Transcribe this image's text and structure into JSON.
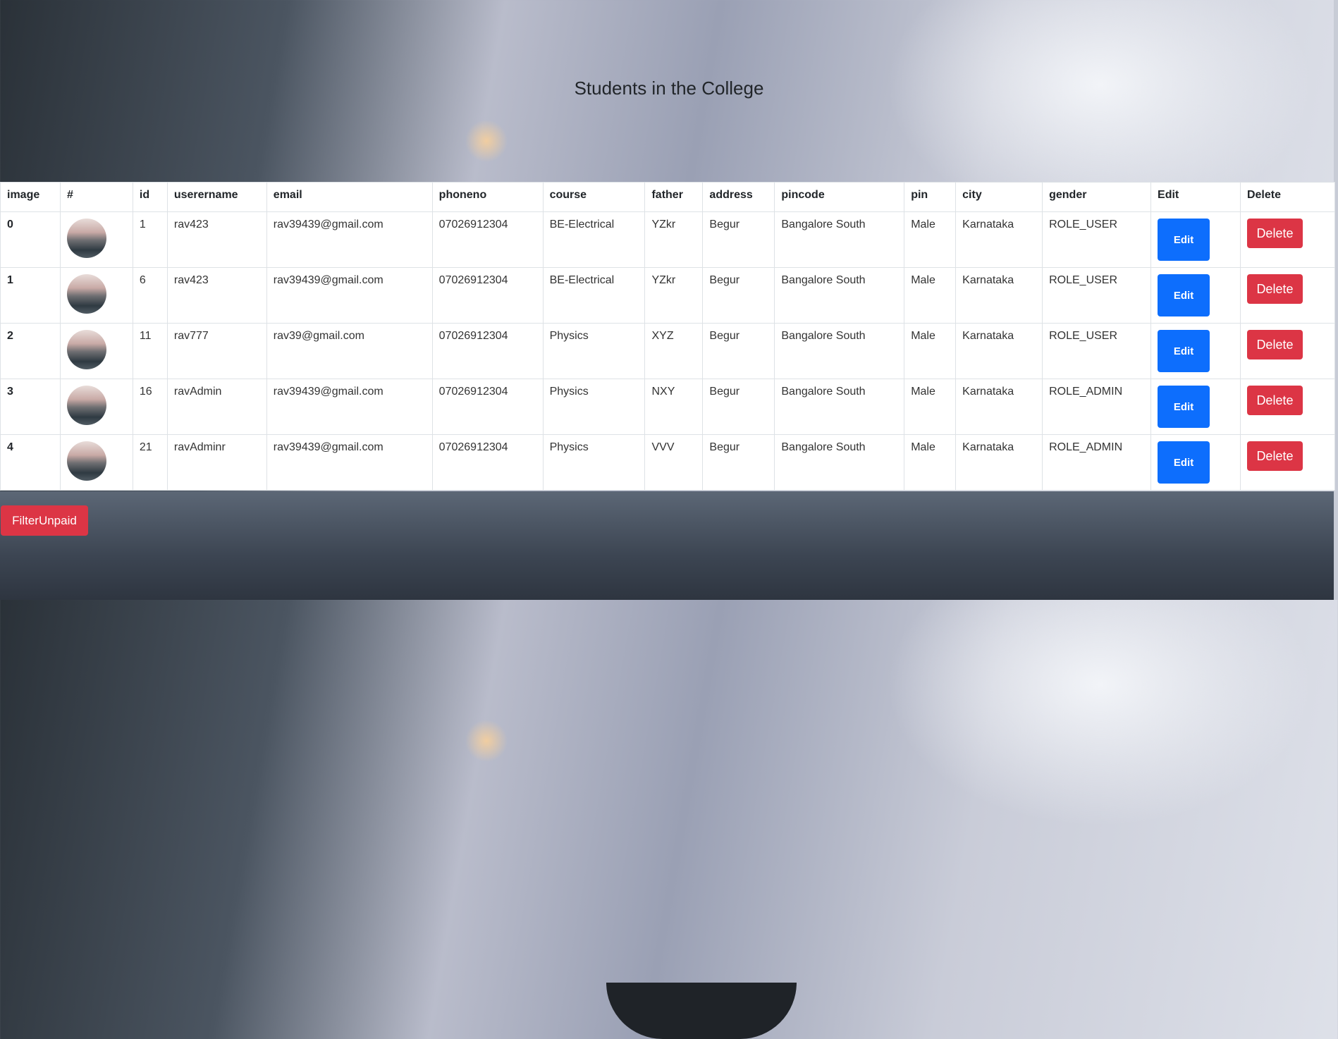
{
  "title": "Students in the College",
  "columns": [
    "image",
    "#",
    "id",
    "userername",
    "email",
    "phoneno",
    "course",
    "father",
    "address",
    "pincode",
    "pin",
    "city",
    "gender",
    "Edit",
    "Delete"
  ],
  "rows": [
    {
      "index": "0",
      "id": "1",
      "username": "rav423",
      "email": "rav39439@gmail.com",
      "phoneno": "07026912304",
      "course": "BE-Electrical",
      "father": "YZkr",
      "address": "Begur",
      "pincode": "Bangalore South",
      "pin": "Male",
      "city": "Karnataka",
      "gender": "ROLE_USER",
      "edit": "Edit",
      "delete": "Delete"
    },
    {
      "index": "1",
      "id": "6",
      "username": "rav423",
      "email": "rav39439@gmail.com",
      "phoneno": "07026912304",
      "course": "BE-Electrical",
      "father": "YZkr",
      "address": "Begur",
      "pincode": "Bangalore South",
      "pin": "Male",
      "city": "Karnataka",
      "gender": "ROLE_USER",
      "edit": "Edit",
      "delete": "Delete"
    },
    {
      "index": "2",
      "id": "11",
      "username": "rav777",
      "email": "rav39@gmail.com",
      "phoneno": "07026912304",
      "course": "Physics",
      "father": "XYZ",
      "address": "Begur",
      "pincode": "Bangalore South",
      "pin": "Male",
      "city": "Karnataka",
      "gender": "ROLE_USER",
      "edit": "Edit",
      "delete": "Delete"
    },
    {
      "index": "3",
      "id": "16",
      "username": "ravAdmin",
      "email": "rav39439@gmail.com",
      "phoneno": "07026912304",
      "course": "Physics",
      "father": "NXY",
      "address": "Begur",
      "pincode": "Bangalore South",
      "pin": "Male",
      "city": "Karnataka",
      "gender": "ROLE_ADMIN",
      "edit": "Edit",
      "delete": "Delete"
    },
    {
      "index": "4",
      "id": "21",
      "username": "ravAdminr",
      "email": "rav39439@gmail.com",
      "phoneno": "07026912304",
      "course": "Physics",
      "father": "VVV",
      "address": "Begur",
      "pincode": "Bangalore South",
      "pin": "Male",
      "city": "Karnataka",
      "gender": "ROLE_ADMIN",
      "edit": "Edit",
      "delete": "Delete"
    }
  ],
  "filter_label": "FilterUnpaid",
  "colors": {
    "primary": "#0d6efd",
    "danger": "#dc3545"
  }
}
